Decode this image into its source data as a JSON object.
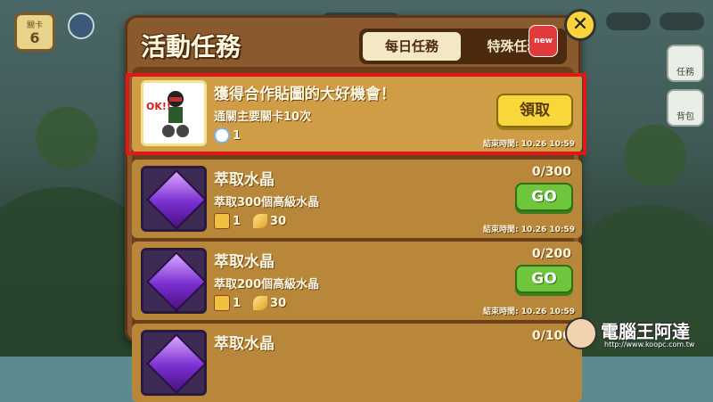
{
  "hud": {
    "stage_label": "關卡",
    "stage_number": "6",
    "side_task_label": "任務",
    "side_shop_label": "背包"
  },
  "panel": {
    "title": "活動任務",
    "tabs": [
      {
        "label": "每日任務",
        "active": true
      },
      {
        "label": "特殊任務",
        "active": false,
        "badge": "new"
      }
    ],
    "close_icon": "✕"
  },
  "tasks": [
    {
      "icon": "sticker-icon",
      "icon_text": "OK!!",
      "title": "獲得合作貼圖的大好機會！",
      "description": "通關主要關卡10次",
      "rewards": [
        {
          "icon": "bear-coin-icon",
          "value": "1"
        }
      ],
      "progress": "",
      "button": "領取",
      "button_type": "claim",
      "end_time": "結束時間: 10.26 10:59",
      "highlighted": true
    },
    {
      "icon": "crystal-icon",
      "title": "萃取水晶",
      "description": "萃取300個高級水晶",
      "rewards": [
        {
          "icon": "box-icon",
          "value": "1"
        },
        {
          "icon": "feather-icon",
          "value": "30"
        }
      ],
      "progress": "0/300",
      "button": "GO",
      "button_type": "go",
      "end_time": "結束時間: 10.26 10:59",
      "highlighted": false
    },
    {
      "icon": "crystal-icon",
      "title": "萃取水晶",
      "description": "萃取200個高級水晶",
      "rewards": [
        {
          "icon": "box-icon",
          "value": "1"
        },
        {
          "icon": "feather-icon",
          "value": "30"
        }
      ],
      "progress": "0/200",
      "button": "GO",
      "button_type": "go",
      "end_time": "結束時間: 10.26 10:59",
      "highlighted": false
    },
    {
      "icon": "crystal-icon",
      "title": "萃取水晶",
      "progress": "0/100",
      "highlighted": false
    }
  ],
  "watermark": {
    "text": "電腦王阿達",
    "url": "http://www.koopc.com.tw"
  },
  "colors": {
    "panel_wood": "#8a5a2e",
    "row_highlight_border": "#e01818",
    "claim_button": "#f7d73a",
    "go_button": "#6fc53c"
  }
}
